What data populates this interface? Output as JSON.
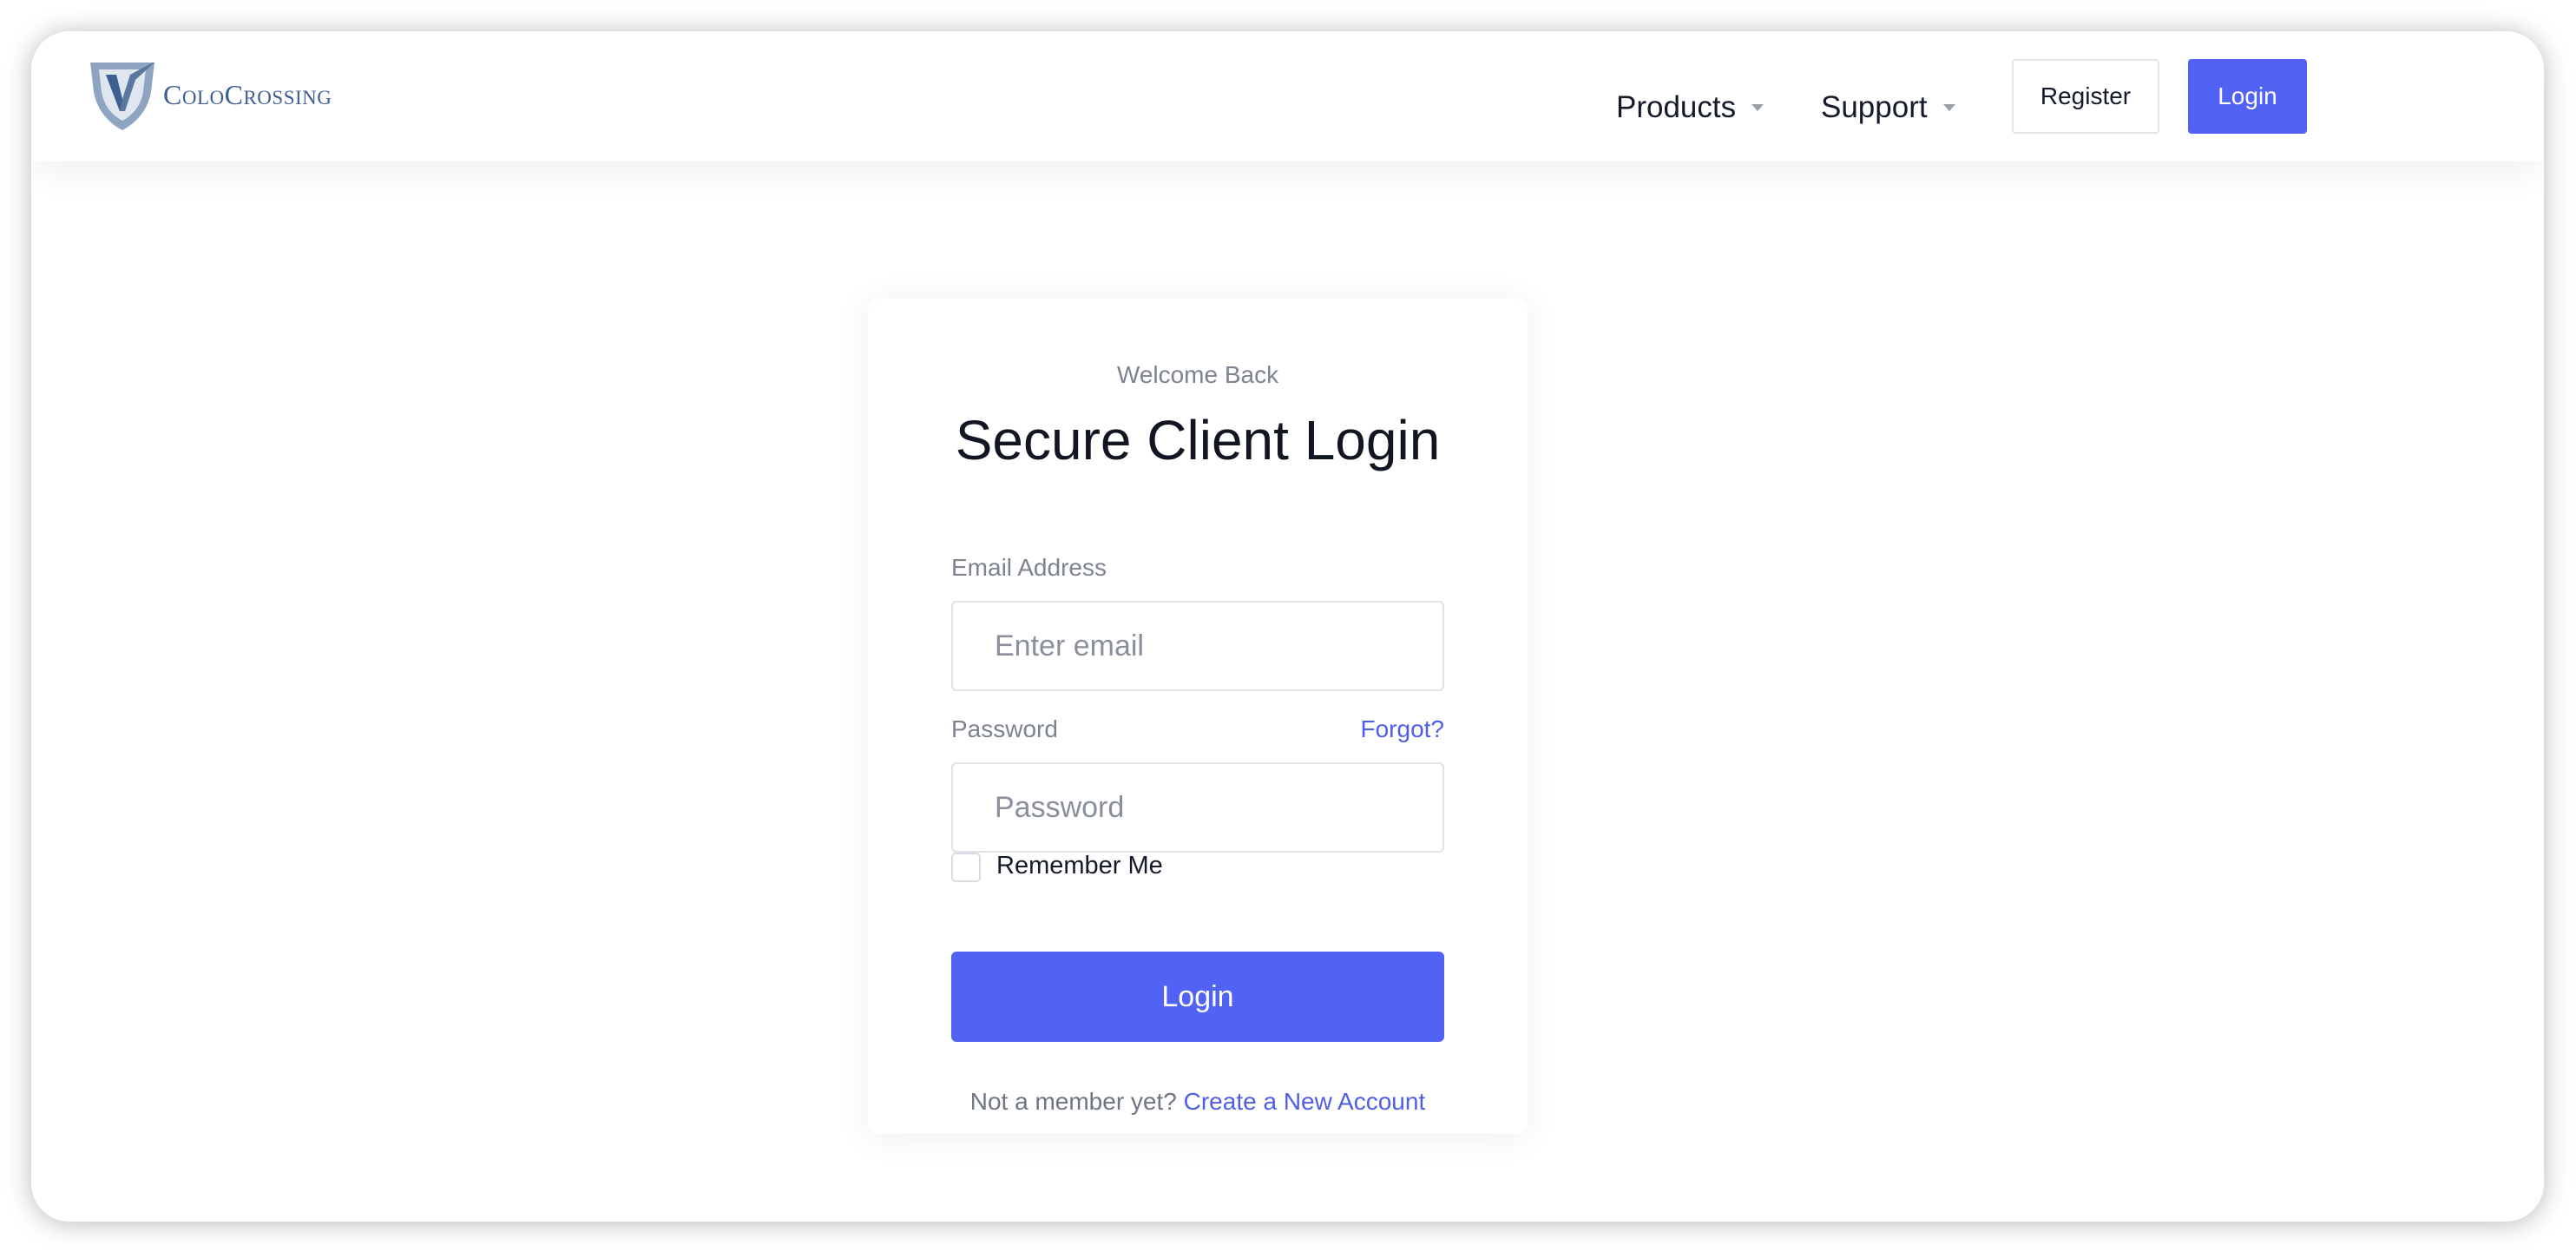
{
  "header": {
    "logo": {
      "icon": "shield-v-logo-icon",
      "text_parts": [
        "C",
        "OLO",
        "C",
        "ROSSING"
      ]
    },
    "nav": [
      {
        "label": "Products",
        "icon": "caret-down-icon"
      },
      {
        "label": "Support",
        "icon": "caret-down-icon"
      }
    ],
    "register_label": "Register",
    "login_label": "Login"
  },
  "login_card": {
    "welcome": "Welcome Back",
    "title": "Secure Client Login",
    "email": {
      "label": "Email Address",
      "placeholder": "Enter email",
      "value": ""
    },
    "password": {
      "label": "Password",
      "placeholder": "Password",
      "value": "",
      "forgot_label": "Forgot?"
    },
    "remember": {
      "label": "Remember Me",
      "checked": false
    },
    "submit_label": "Login",
    "signup_prompt": "Not a member yet?",
    "signup_link": "Create a New Account"
  },
  "colors": {
    "accent": "#5162f5",
    "link": "#4f5ee6",
    "logo_text": "#3d5f92"
  }
}
